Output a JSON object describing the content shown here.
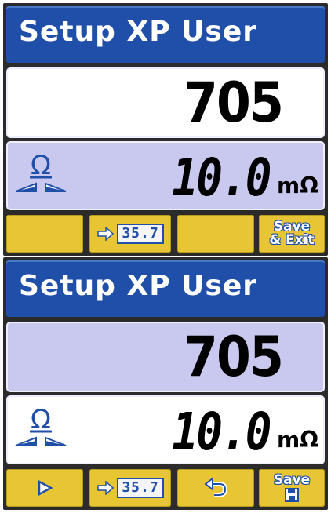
{
  "screens": [
    {
      "title": "Setup XP User",
      "value": "705",
      "measurement": "10.0",
      "unit": "mΩ",
      "softkeys": [
        {
          "icon": "blank"
        },
        {
          "icon": "right-arrow-icon",
          "text": "35.7"
        },
        {
          "icon": "blank"
        },
        {
          "line1": "Save",
          "line2": "& Exit"
        }
      ]
    },
    {
      "title": "Setup XP User",
      "value": "705",
      "measurement": "10.0",
      "unit": "mΩ",
      "softkeys": [
        {
          "icon": "play-icon"
        },
        {
          "icon": "right-arrow-icon",
          "text": "35.7"
        },
        {
          "icon": "undo-icon"
        },
        {
          "line1": "Save",
          "icon": "floppy-disk-icon"
        }
      ]
    }
  ],
  "colors": {
    "title_bar": "#1f4fa8",
    "softkey": "#e8c534",
    "panel_lavender": "#c9c9f0",
    "bezel": "#2b2b2b"
  }
}
